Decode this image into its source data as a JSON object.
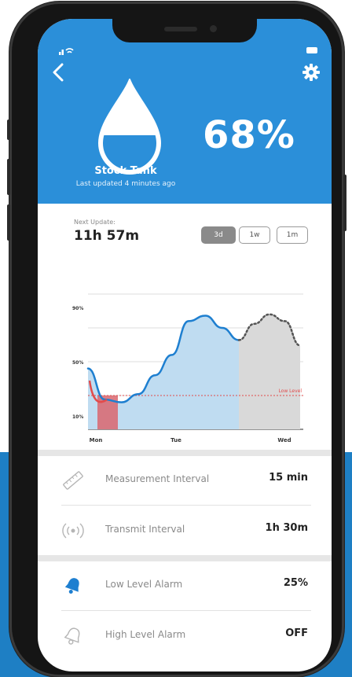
{
  "header": {
    "percent": "68%",
    "tank_name": "Stock Tank",
    "updated": "Last updated 4 minutes ago"
  },
  "next_update": {
    "label": "Next Update:",
    "value": "11h 57m"
  },
  "ranges": [
    "3d",
    "1w",
    "1m"
  ],
  "selected_range": "3d",
  "chart_data": {
    "type": "area",
    "x_ticks": [
      "Mon",
      "Tue",
      "Wed"
    ],
    "y_ticks": [
      "90%",
      "50%",
      "10%"
    ],
    "threshold_label": "Low Level",
    "threshold": 25,
    "series": [
      {
        "values": [
          45,
          22,
          20,
          26,
          40,
          55,
          80,
          84,
          75,
          66
        ]
      },
      {
        "values": [
          66,
          78,
          85,
          80,
          62
        ]
      }
    ]
  },
  "settings": [
    {
      "icon": "ruler-icon",
      "label": "Measurement Interval",
      "value": "15 min"
    },
    {
      "icon": "broadcast-icon",
      "label": "Transmit Interval",
      "value": "1h 30m"
    },
    {
      "icon": "bell-icon",
      "label": "Low Level Alarm",
      "value": "25%"
    },
    {
      "icon": "bell-outline-icon",
      "label": "High Level Alarm",
      "value": "OFF"
    }
  ],
  "colors": {
    "header": "#2b8fd9",
    "line": "#1e7fd0",
    "area": "#bfdcf1",
    "forecast": "#d9d9d9",
    "low_level": "#e24b4b"
  }
}
